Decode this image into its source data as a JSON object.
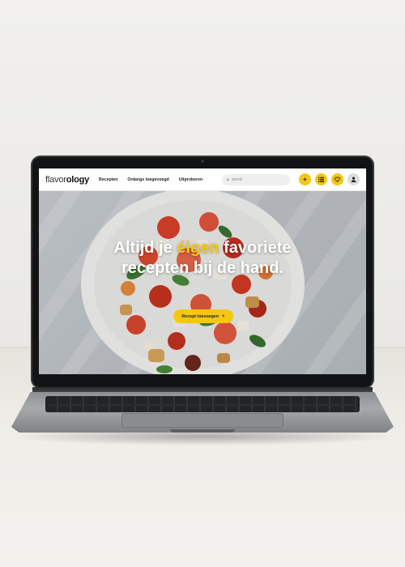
{
  "site": {
    "logo_light": "flavor",
    "logo_bold": "ology",
    "nav": [
      {
        "label": "Recepten"
      },
      {
        "label": "Onlangs toegevoegd"
      },
      {
        "label": "Uitproberen"
      }
    ],
    "search": {
      "placeholder": "zoeck"
    },
    "icons": [
      "plus-icon",
      "list-icon",
      "heart-icon",
      "user-icon"
    ],
    "accent_color": "#f5c710"
  },
  "hero": {
    "line1_a": "Altijd je ",
    "line1_highlight": "éigen",
    "line1_b": " favoriete",
    "line2": "recepten bij de hand.",
    "cta_label": "Recept toevoegen",
    "cta_icon": "+"
  }
}
